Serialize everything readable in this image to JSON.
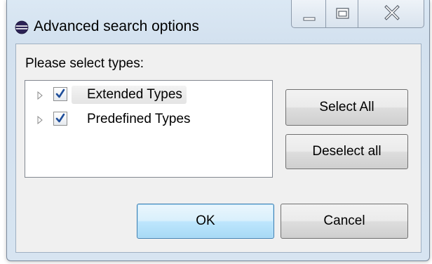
{
  "window": {
    "title": "Advanced search options",
    "icon": "eclipse-icon",
    "caption_buttons": [
      "minimize",
      "maximize",
      "close"
    ]
  },
  "dialog": {
    "prompt": "Please select types:",
    "tree": [
      {
        "label": "Extended Types",
        "checked": true,
        "expandable": true,
        "selected": true
      },
      {
        "label": "Predefined Types",
        "checked": true,
        "expandable": true,
        "selected": false
      }
    ],
    "select_all_label": "Select All",
    "deselect_all_label": "Deselect all",
    "ok_label": "OK",
    "cancel_label": "Cancel"
  },
  "colors": {
    "window_frame": "#d3e1ef",
    "client_bg": "#f0f0f0",
    "default_button": "#bee6fd",
    "checkmark": "#1f4e9a"
  }
}
